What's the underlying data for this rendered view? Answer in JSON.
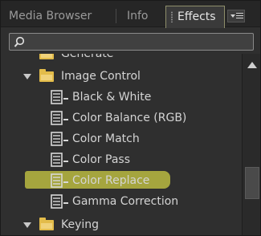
{
  "tabs": [
    {
      "label": "Media Browser"
    },
    {
      "label": "Info"
    },
    {
      "label": "Effects",
      "active": true
    }
  ],
  "search": {
    "value": "",
    "placeholder": ""
  },
  "tree": {
    "generate": "Generate",
    "image_control": "Image Control",
    "effects": [
      "Black & White",
      "Color Balance (RGB)",
      "Color Match",
      "Color Pass",
      "Color Replace",
      "Gamma Correction"
    ],
    "keying": "Keying",
    "selected_effect": "Color Replace"
  },
  "colors": {
    "panel_bg": "#2f2f2f",
    "folder": "#e3bc4a",
    "highlight": "#c7c743",
    "text": "#d4d4d4"
  },
  "icons": {
    "folder": "folder-icon",
    "effect": "video-effect-icon",
    "twisty": "disclosure-triangle-icon"
  }
}
